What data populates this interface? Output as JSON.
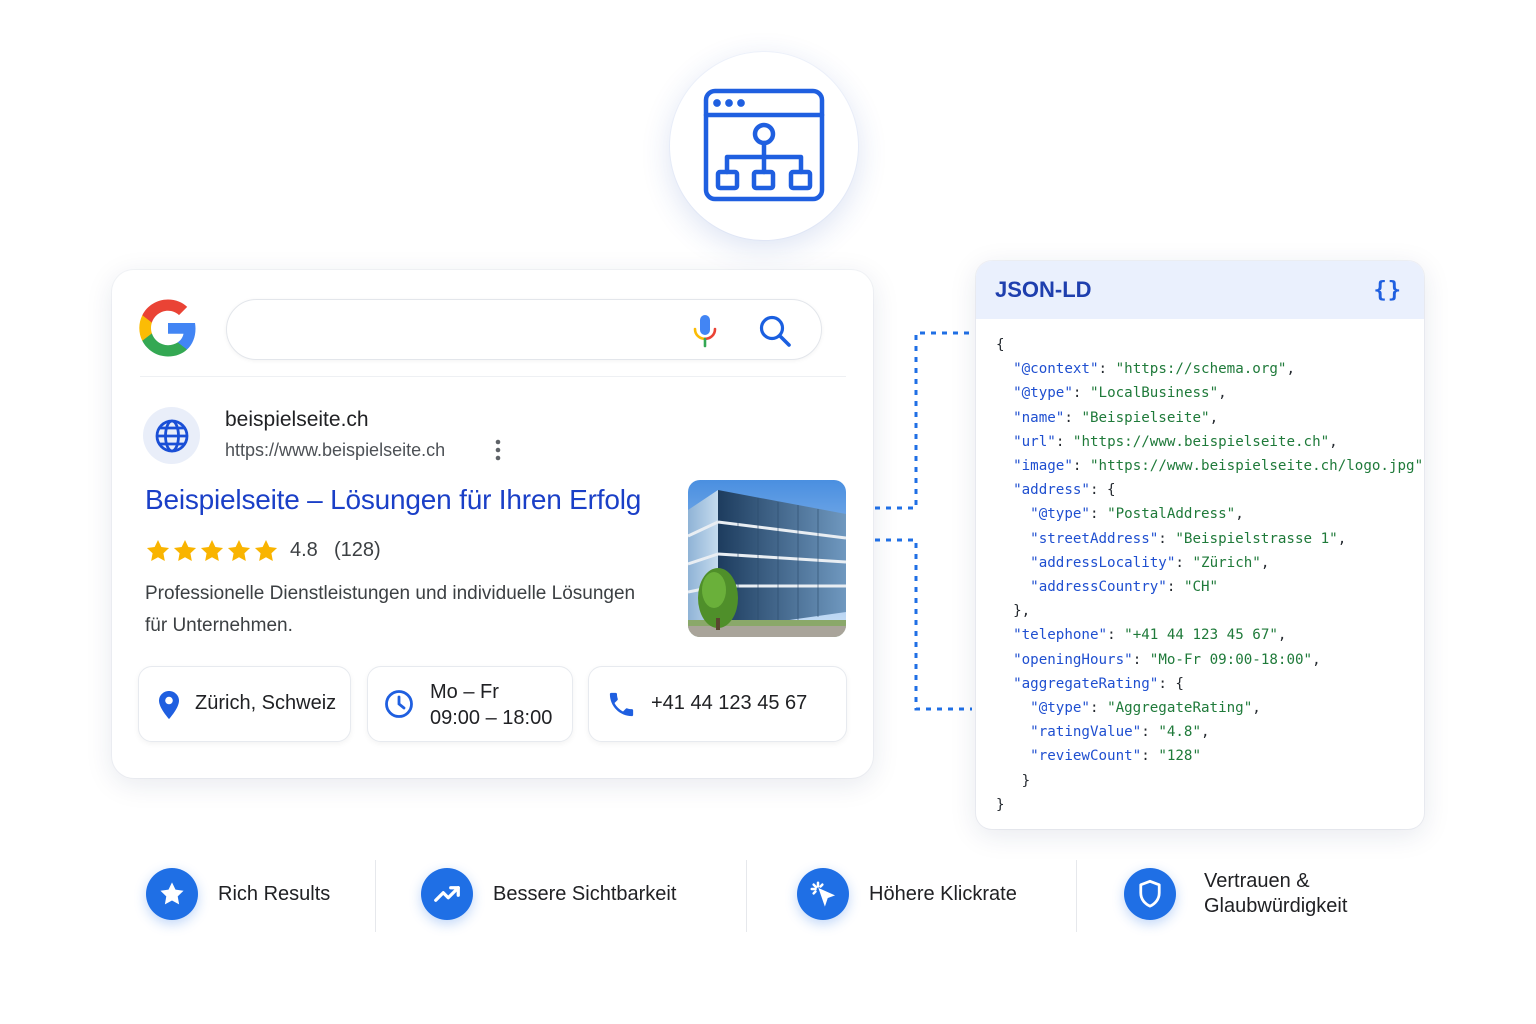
{
  "hero": {
    "icon": "website-sitemap-icon"
  },
  "search": {
    "logo": "google-logo",
    "query": "",
    "mic_icon": "microphone-icon",
    "search_icon": "search-icon"
  },
  "result": {
    "site_name": "beispielseite.ch",
    "url": "https://www.beispielseite.ch",
    "title": "Beispielseite – Lösungen für Ihren Erfolg",
    "rating_stars": 5,
    "rating_value": "4.8",
    "rating_count": "(128)",
    "description_line1": "Professionelle Dienstleistungen und individuelle Lösungen",
    "description_line2": "für Unternehmen.",
    "thumbnail": "office-building-photo"
  },
  "chips": {
    "location": "Zürich, Schweiz",
    "hours_line1": "Mo – Fr",
    "hours_line2": "09:00 – 18:00",
    "phone": "+41 44 123 45 67"
  },
  "json_ld": {
    "title": "JSON-LD",
    "brace_icon": "{}",
    "lines": [
      [
        [
          "p",
          "{"
        ]
      ],
      [
        [
          "p",
          "  "
        ],
        [
          "k",
          "\"@context\""
        ],
        [
          "p",
          ": "
        ],
        [
          "s",
          "\"https://schema.org\""
        ],
        [
          "p",
          ","
        ]
      ],
      [
        [
          "p",
          "  "
        ],
        [
          "k",
          "\"@type\""
        ],
        [
          "p",
          ": "
        ],
        [
          "s",
          "\"LocalBusiness\""
        ],
        [
          "p",
          ","
        ]
      ],
      [
        [
          "p",
          "  "
        ],
        [
          "k",
          "\"name\""
        ],
        [
          "p",
          ": "
        ],
        [
          "s",
          "\"Beispielseite\""
        ],
        [
          "p",
          ","
        ]
      ],
      [
        [
          "p",
          "  "
        ],
        [
          "k",
          "\"url\""
        ],
        [
          "p",
          ": "
        ],
        [
          "s",
          "\"https://www.beispielseite.ch\""
        ],
        [
          "p",
          ","
        ]
      ],
      [
        [
          "p",
          "  "
        ],
        [
          "k",
          "\"image\""
        ],
        [
          "p",
          ": "
        ],
        [
          "s",
          "\"https://www.beispielseite.ch/logo.jpg\""
        ],
        [
          "p",
          ","
        ]
      ],
      [
        [
          "p",
          "  "
        ],
        [
          "k",
          "\"address\""
        ],
        [
          "p",
          ": {"
        ]
      ],
      [
        [
          "p",
          "    "
        ],
        [
          "k",
          "\"@type\""
        ],
        [
          "p",
          ": "
        ],
        [
          "s",
          "\"PostalAddress\""
        ],
        [
          "p",
          ","
        ]
      ],
      [
        [
          "p",
          "    "
        ],
        [
          "k",
          "\"streetAddress\""
        ],
        [
          "p",
          ": "
        ],
        [
          "s",
          "\"Beispielstrasse 1\""
        ],
        [
          "p",
          ","
        ]
      ],
      [
        [
          "p",
          "    "
        ],
        [
          "k",
          "\"addressLocality\""
        ],
        [
          "p",
          ": "
        ],
        [
          "s",
          "\"Zürich\""
        ],
        [
          "p",
          ","
        ]
      ],
      [
        [
          "p",
          "    "
        ],
        [
          "k",
          "\"addressCountry\""
        ],
        [
          "p",
          ": "
        ],
        [
          "s",
          "\"CH\""
        ]
      ],
      [
        [
          "p",
          "  },"
        ]
      ],
      [
        [
          "p",
          "  "
        ],
        [
          "k",
          "\"telephone\""
        ],
        [
          "p",
          ": "
        ],
        [
          "s",
          "\"+41 44 123 45 67\""
        ],
        [
          "p",
          ","
        ]
      ],
      [
        [
          "p",
          "  "
        ],
        [
          "k",
          "\"openingHours\""
        ],
        [
          "p",
          ": "
        ],
        [
          "s",
          "\"Mo-Fr 09:00-18:00\""
        ],
        [
          "p",
          ","
        ]
      ],
      [
        [
          "p",
          "  "
        ],
        [
          "k",
          "\"aggregateRating\""
        ],
        [
          "p",
          ": {"
        ]
      ],
      [
        [
          "p",
          "    "
        ],
        [
          "k",
          "\"@type\""
        ],
        [
          "p",
          ": "
        ],
        [
          "s",
          "\"AggregateRating\""
        ],
        [
          "p",
          ","
        ]
      ],
      [
        [
          "p",
          "    "
        ],
        [
          "k",
          "\"ratingValue\""
        ],
        [
          "p",
          ": "
        ],
        [
          "s",
          "\"4.8\""
        ],
        [
          "p",
          ","
        ]
      ],
      [
        [
          "p",
          "    "
        ],
        [
          "k",
          "\"reviewCount\""
        ],
        [
          "p",
          ": "
        ],
        [
          "s",
          "\"128\""
        ]
      ],
      [
        [
          "p",
          "   }"
        ]
      ],
      [
        [
          "p",
          "}"
        ]
      ]
    ]
  },
  "features": [
    {
      "label": "Rich Results",
      "icon": "star-icon"
    },
    {
      "label": "Bessere Sichtbarkeit",
      "icon": "trending-up-icon"
    },
    {
      "label": "Höhere Klickrate",
      "icon": "click-cursor-icon"
    },
    {
      "label_line1": "Vertrauen &",
      "label_line2": "Glaubwürdigkeit",
      "icon": "shield-icon"
    }
  ],
  "colors": {
    "accent": "#1f6fe5",
    "link": "#1a3fc7",
    "star": "#f9b400",
    "json_key": "#1f4fd0",
    "json_string": "#1f7a3a"
  }
}
